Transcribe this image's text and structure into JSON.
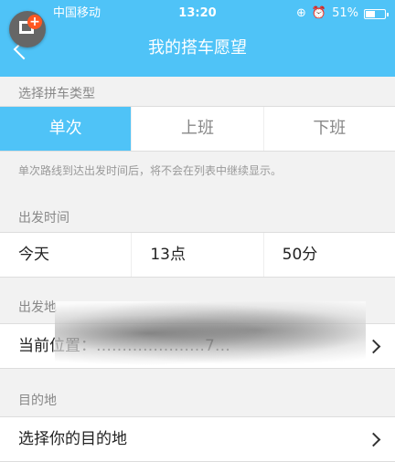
{
  "status_bar": {
    "carrier": "中国移动",
    "time": "13:20",
    "battery": "51%",
    "battery_level": 0.51
  },
  "header": {
    "title": "我的搭车愿望"
  },
  "ride_type": {
    "label": "选择拼车类型",
    "options": [
      "单次",
      "上班",
      "下班"
    ],
    "selected": "单次",
    "note": "单次路线到达出发时间后，将不会在列表中继续显示。"
  },
  "departure_time": {
    "label": "出发时间",
    "day": "今天",
    "hour": "13点",
    "minute": "50分"
  },
  "origin": {
    "label": "出发地",
    "value": "当前位置：…………………7…"
  },
  "destination": {
    "label": "目的地",
    "placeholder": "选择你的目的地"
  },
  "colors": {
    "accent": "#4fc3f7",
    "background": "#f2f2f2"
  }
}
